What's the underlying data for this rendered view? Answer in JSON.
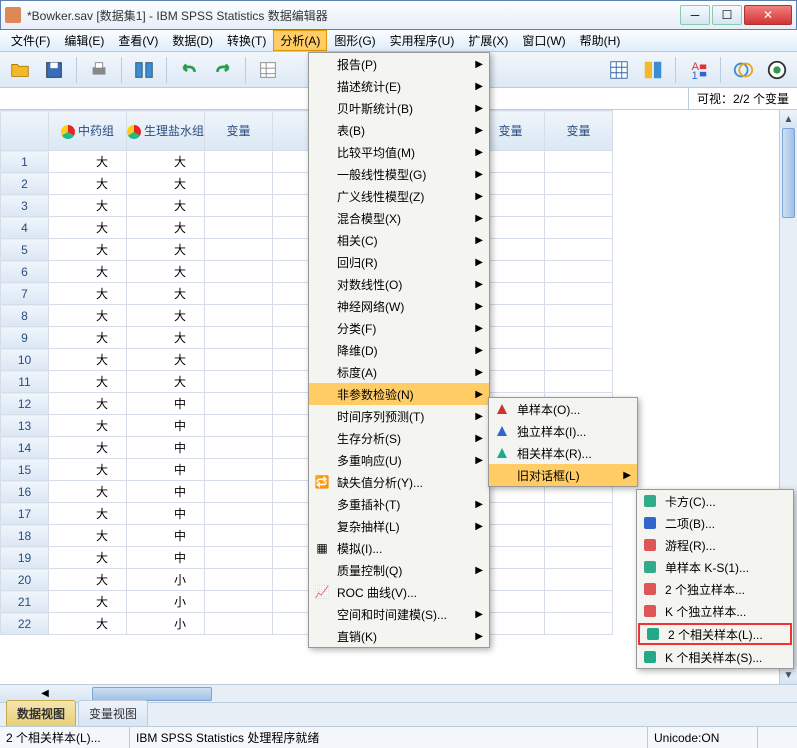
{
  "title": "*Bowker.sav [数据集1] - IBM SPSS Statistics 数据编辑器",
  "menu": {
    "file": "文件(F)",
    "edit": "编辑(E)",
    "view": "查看(V)",
    "data": "数据(D)",
    "transform": "转换(T)",
    "analyze": "分析(A)",
    "graphs": "图形(G)",
    "utilities": "实用程序(U)",
    "extensions": "扩展(X)",
    "window": "窗口(W)",
    "help": "帮助(H)"
  },
  "visible_label": "可视：2/2 个变量",
  "columns": {
    "c1": "中药组",
    "c2": "生理盐水组",
    "var": "变量"
  },
  "rows": [
    {
      "n": "1",
      "a": "大",
      "b": "大"
    },
    {
      "n": "2",
      "a": "大",
      "b": "大"
    },
    {
      "n": "3",
      "a": "大",
      "b": "大"
    },
    {
      "n": "4",
      "a": "大",
      "b": "大"
    },
    {
      "n": "5",
      "a": "大",
      "b": "大"
    },
    {
      "n": "6",
      "a": "大",
      "b": "大"
    },
    {
      "n": "7",
      "a": "大",
      "b": "大"
    },
    {
      "n": "8",
      "a": "大",
      "b": "大"
    },
    {
      "n": "9",
      "a": "大",
      "b": "大"
    },
    {
      "n": "10",
      "a": "大",
      "b": "大"
    },
    {
      "n": "11",
      "a": "大",
      "b": "大"
    },
    {
      "n": "12",
      "a": "大",
      "b": "中"
    },
    {
      "n": "13",
      "a": "大",
      "b": "中"
    },
    {
      "n": "14",
      "a": "大",
      "b": "中"
    },
    {
      "n": "15",
      "a": "大",
      "b": "中"
    },
    {
      "n": "16",
      "a": "大",
      "b": "中"
    },
    {
      "n": "17",
      "a": "大",
      "b": "中"
    },
    {
      "n": "18",
      "a": "大",
      "b": "中"
    },
    {
      "n": "19",
      "a": "大",
      "b": "中"
    },
    {
      "n": "20",
      "a": "大",
      "b": "小"
    },
    {
      "n": "21",
      "a": "大",
      "b": "小"
    },
    {
      "n": "22",
      "a": "大",
      "b": "小"
    }
  ],
  "analyze_menu": [
    {
      "l": "报告(P)",
      "a": true
    },
    {
      "l": "描述统计(E)",
      "a": true
    },
    {
      "l": "贝叶斯统计(B)",
      "a": true
    },
    {
      "l": "表(B)",
      "a": true
    },
    {
      "l": "比较平均值(M)",
      "a": true
    },
    {
      "l": "一般线性模型(G)",
      "a": true
    },
    {
      "l": "广义线性模型(Z)",
      "a": true
    },
    {
      "l": "混合模型(X)",
      "a": true
    },
    {
      "l": "相关(C)",
      "a": true
    },
    {
      "l": "回归(R)",
      "a": true
    },
    {
      "l": "对数线性(O)",
      "a": true
    },
    {
      "l": "神经网络(W)",
      "a": true
    },
    {
      "l": "分类(F)",
      "a": true
    },
    {
      "l": "降维(D)",
      "a": true
    },
    {
      "l": "标度(A)",
      "a": true
    },
    {
      "l": "非参数检验(N)",
      "a": true,
      "hl": true
    },
    {
      "l": "时间序列预测(T)",
      "a": true
    },
    {
      "l": "生存分析(S)",
      "a": true
    },
    {
      "l": "多重响应(U)",
      "a": true
    },
    {
      "l": "缺失值分析(Y)...",
      "a": false,
      "icon": "missing"
    },
    {
      "l": "多重插补(T)",
      "a": true
    },
    {
      "l": "复杂抽样(L)",
      "a": true
    },
    {
      "l": "模拟(I)...",
      "a": false,
      "icon": "sim"
    },
    {
      "l": "质量控制(Q)",
      "a": true
    },
    {
      "l": "ROC 曲线(V)...",
      "a": false,
      "icon": "roc"
    },
    {
      "l": "空间和时间建模(S)...",
      "a": true
    },
    {
      "l": "直销(K)",
      "a": true
    }
  ],
  "nonparam_menu": [
    {
      "l": "单样本(O)...",
      "c": "#c33"
    },
    {
      "l": "独立样本(I)...",
      "c": "#36c"
    },
    {
      "l": "相关样本(R)...",
      "c": "#2a8"
    },
    {
      "l": "旧对话框(L)",
      "a": true,
      "hl": true
    }
  ],
  "legacy_menu": [
    {
      "l": "卡方(C)...",
      "ic": "chi"
    },
    {
      "l": "二项(B)...",
      "ic": "bin"
    },
    {
      "l": "游程(R)...",
      "ic": "run"
    },
    {
      "l": "单样本 K-S(1)...",
      "ic": "ks"
    },
    {
      "l": "2 个独立样本...",
      "ic": "i2"
    },
    {
      "l": "K 个独立样本...",
      "ic": "ik"
    },
    {
      "l": "2 个相关样本(L)...",
      "ic": "r2",
      "boxed": true
    },
    {
      "l": "K 个相关样本(S)...",
      "ic": "rk"
    }
  ],
  "tabs": {
    "data": "数据视图",
    "var": "变量视图"
  },
  "status": {
    "left": "2 个相关样本(L)...",
    "mid": "IBM SPSS Statistics 处理程序就绪",
    "right": "Unicode:ON"
  }
}
